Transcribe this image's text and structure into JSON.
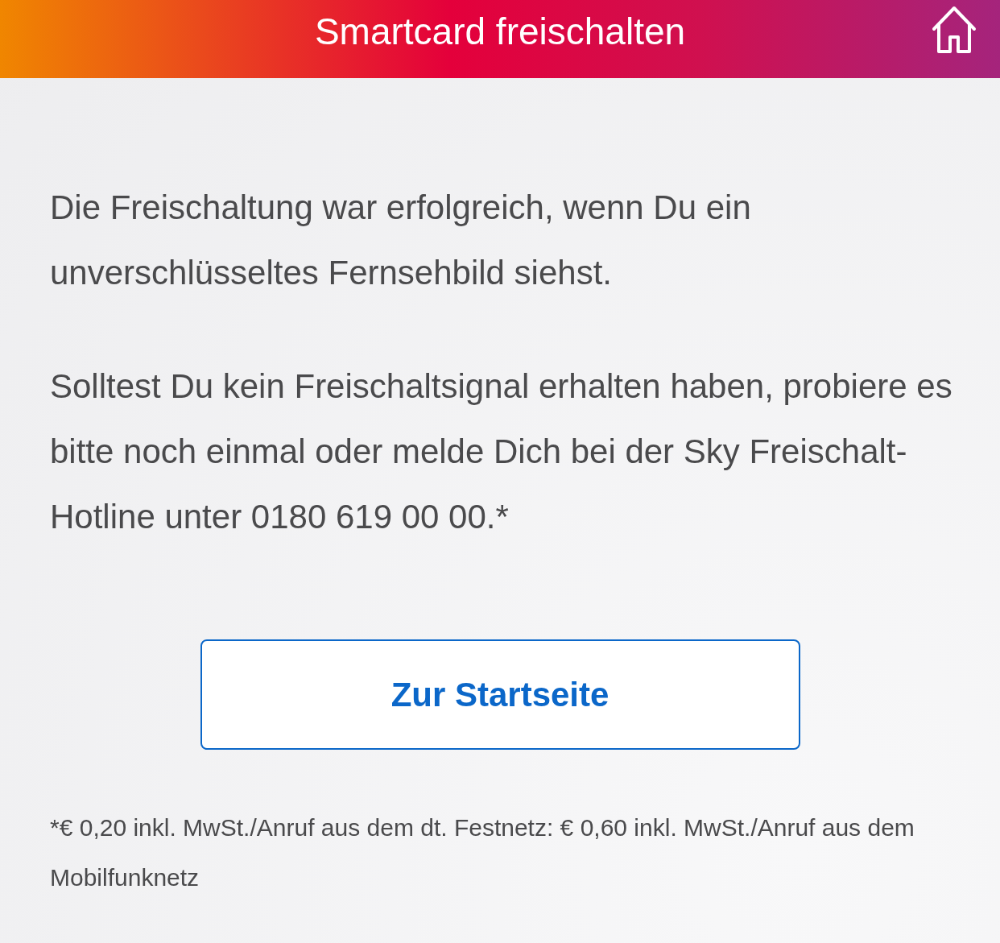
{
  "header": {
    "title": "Smartcard freischalten"
  },
  "paragraphs": [
    "Die Freischaltung war erfolgreich, wenn Du ein unverschlüsseltes Fernsehbild siehst.",
    "Solltest Du kein Freischaltsignal erhalten haben, probiere es bitte noch einmal oder melde Dich bei der Sky Freischalt-Hotline unter 0180 619 00 00.*"
  ],
  "button": {
    "label": "Zur Startseite"
  },
  "footnote": "*€ 0,20 inkl. MwSt./Anruf aus dem dt. Festnetz: € 0,60 inkl. MwSt./Anruf aus dem Mobilfunknetz"
}
